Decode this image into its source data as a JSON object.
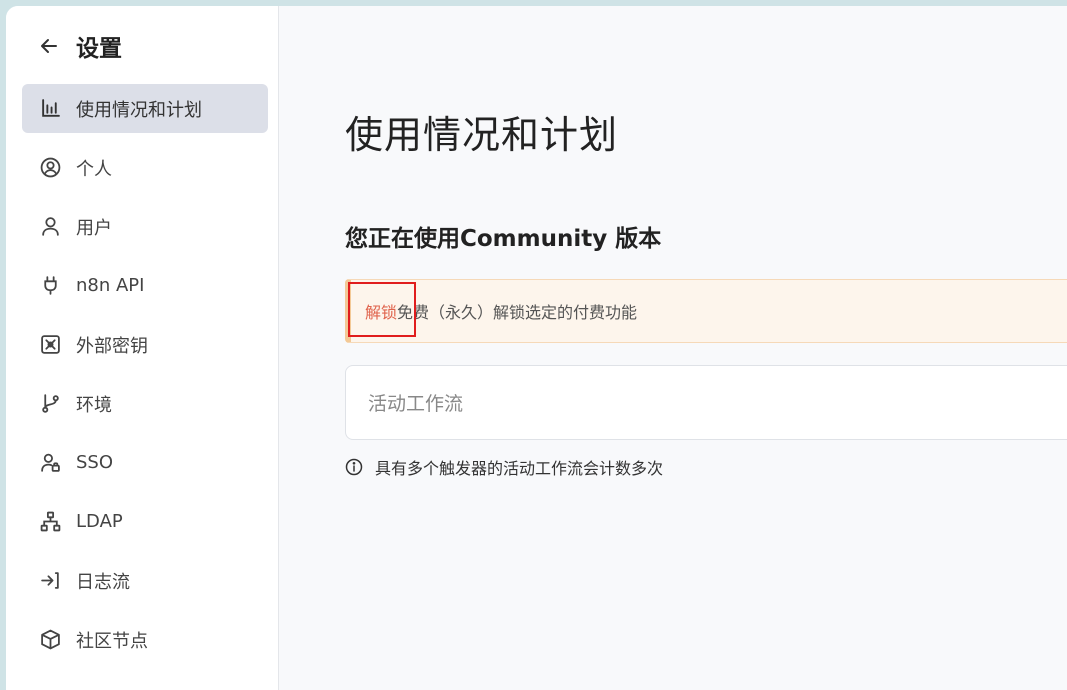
{
  "sidebar": {
    "title": "设置",
    "items": [
      {
        "label": "使用情况和计划",
        "icon": "bar-chart-icon",
        "active": true
      },
      {
        "label": "个人",
        "icon": "user-circle-icon",
        "active": false
      },
      {
        "label": "用户",
        "icon": "user-icon",
        "active": false
      },
      {
        "label": "n8n API",
        "icon": "plug-icon",
        "active": false
      },
      {
        "label": "外部密钥",
        "icon": "vault-icon",
        "active": false
      },
      {
        "label": "环境",
        "icon": "git-branch-icon",
        "active": false
      },
      {
        "label": "SSO",
        "icon": "user-lock-icon",
        "active": false
      },
      {
        "label": "LDAP",
        "icon": "network-icon",
        "active": false
      },
      {
        "label": "日志流",
        "icon": "sign-in-icon",
        "active": false
      },
      {
        "label": "社区节点",
        "icon": "cube-icon",
        "active": false
      }
    ]
  },
  "main": {
    "title": "使用情况和计划",
    "edition_text": "您正在使用Community 版本",
    "callout": {
      "link": "解锁",
      "text": "免费（永久）解锁选定的付费功能"
    },
    "active_workflows_label": "活动工作流",
    "info_text": "具有多个触发器的活动工作流会计数多次"
  },
  "colors": {
    "active_bg": "#dcdfe8",
    "callout_bg": "#fdf5ec",
    "callout_link": "#e0634c",
    "highlight": "#e01d1d"
  }
}
